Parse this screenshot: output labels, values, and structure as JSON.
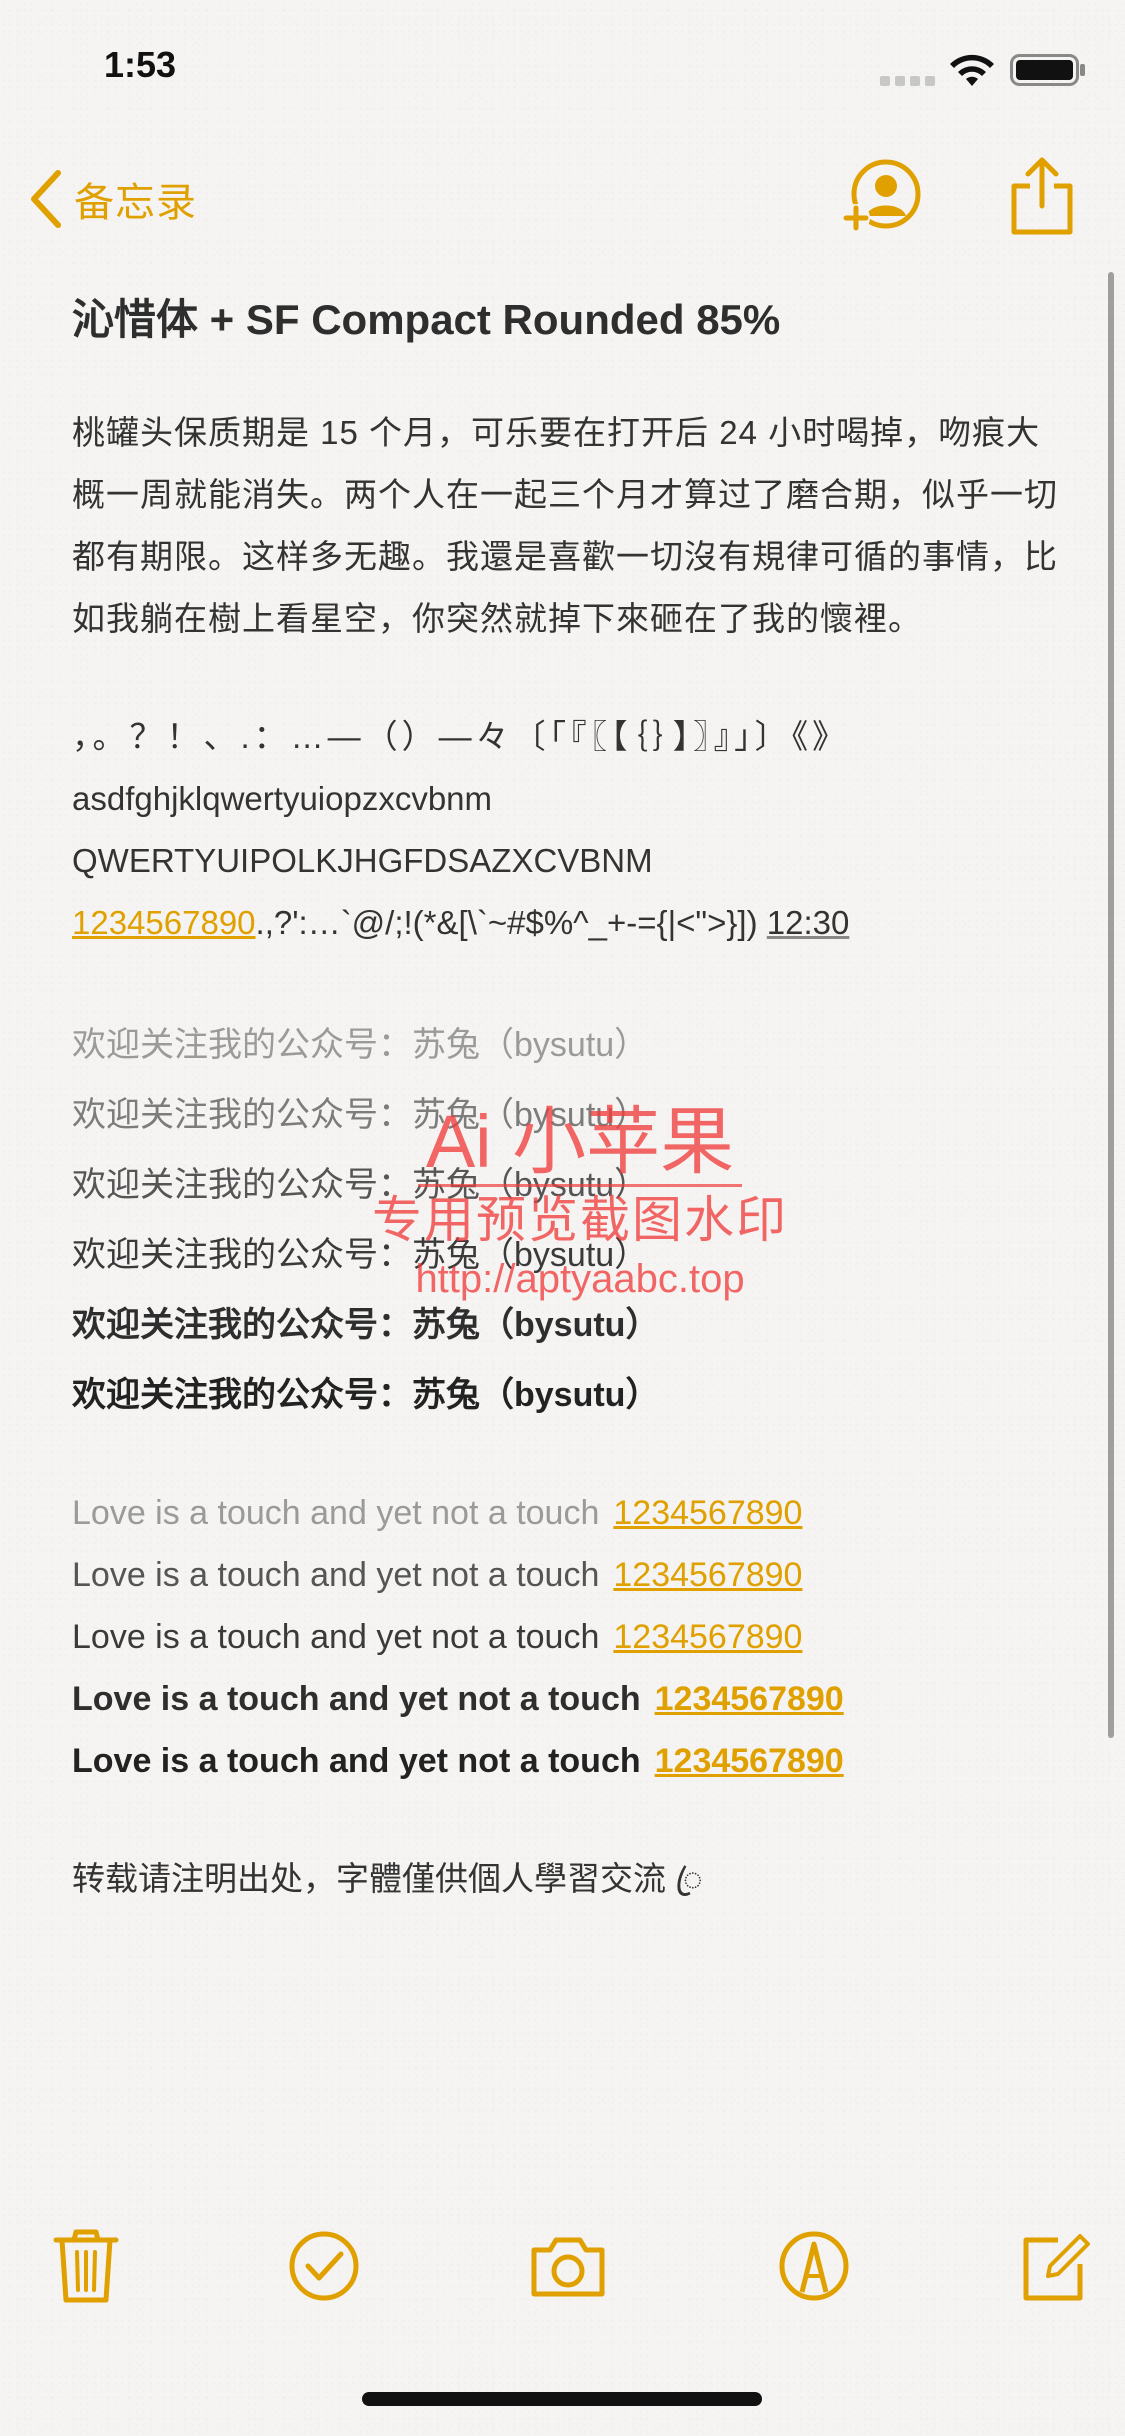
{
  "status_bar": {
    "time": "1:53"
  },
  "nav": {
    "back_label": "备忘录"
  },
  "note": {
    "title": "沁惜体 + SF Compact Rounded 85%",
    "paragraph": "桃罐头保质期是 15 个月，可乐要在打开后 24 小时喝掉，吻痕大概一周就能消失。两个人在一起三个月才算过了磨合期，似乎一切都有期限。这样多无趣。我還是喜歡一切沒有規律可循的事情，比如我躺在樹上看星空，你突然就掉下來砸在了我的懷裡。",
    "symbols": {
      "punctuation": "，。？！、.：…—（）—々〔「『〖【｛｝】〗』」〕《》",
      "lowercase": "asdfghjklqwertyuiopzxcvbnm",
      "uppercase": "QWERTYUIPOLKJHGFDSAZXCVBNM",
      "digits": "1234567890",
      "ascii_symbols": ".,?':…`@/;!(*&[\\`~#$%^_+-={|<\">}])",
      "time": "12:30"
    },
    "follow_lines": [
      "欢迎关注我的公众号：苏兔（bysutu）",
      "欢迎关注我的公众号：苏兔（bysutu）",
      "欢迎关注我的公众号：苏兔（bysutu）",
      "欢迎关注我的公众号：苏兔（bysutu）",
      "欢迎关注我的公众号：苏兔（bysutu）",
      "欢迎关注我的公众号：苏兔（bysutu）"
    ],
    "love_lines": [
      {
        "text": "Love is a touch and yet not a touch",
        "number": "1234567890"
      },
      {
        "text": "Love is a touch and yet not a touch",
        "number": "1234567890"
      },
      {
        "text": "Love is a touch and yet not a touch",
        "number": "1234567890"
      },
      {
        "text": "Love is a touch and yet not a touch",
        "number": "1234567890"
      },
      {
        "text": "Love is a touch and yet not a touch",
        "number": "1234567890"
      }
    ],
    "footer": "转载请注明出处，字體僅供個人學習交流 ꦿ"
  },
  "watermark": {
    "title": "Ai 小苹果",
    "subtitle": "专用预览截图水印",
    "url": "http://aptyaabc.top"
  },
  "colors": {
    "accent": "#e0a000",
    "watermark": "#f03c3c",
    "text": "#2c2c2c"
  },
  "icons": {
    "nav_back": "chevron-left-icon",
    "add_people": "add-person-icon",
    "share": "share-icon",
    "toolbar": [
      "trash-icon",
      "checklist-icon",
      "camera-icon",
      "markup-pen-icon",
      "compose-icon"
    ]
  }
}
